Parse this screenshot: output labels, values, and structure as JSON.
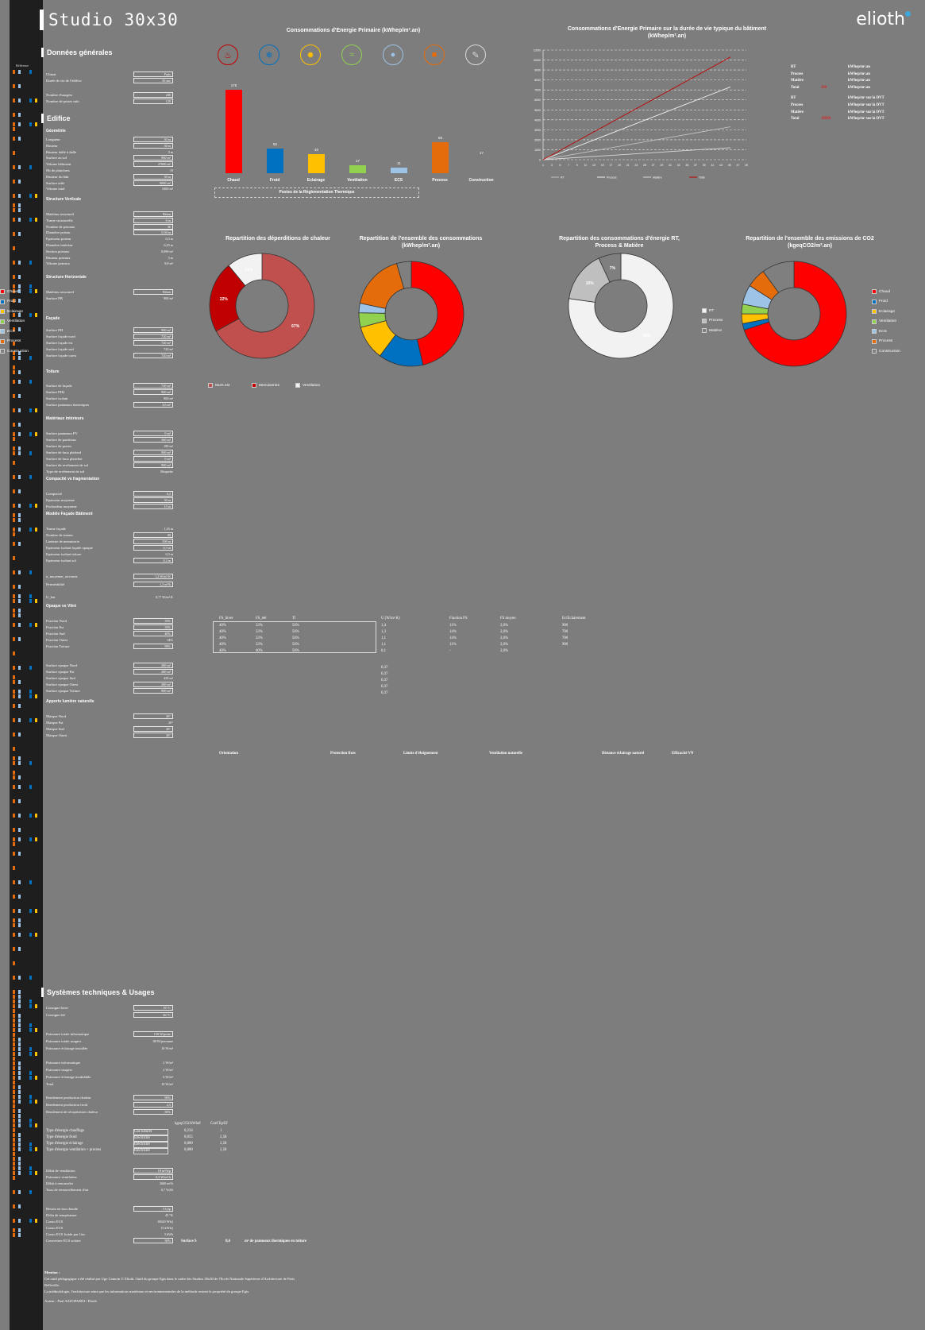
{
  "header": {
    "title": "Studio 30x30",
    "brand": "elioth"
  },
  "sections": {
    "general": "Données générales",
    "edifice": "Edifice",
    "systems": "Systèmes techniques & Usages"
  },
  "sidebar": {
    "reference_label": "Référence"
  },
  "general_params": [
    {
      "label": "Climat",
      "value": "Paris",
      "boxed": true
    },
    {
      "label": "Durée de vie de l'édifice",
      "value": "50 ans",
      "boxed": true
    },
    {
      "label": "Nombre d'usagers",
      "value": "200",
      "boxed": true
    },
    {
      "label": "Nombre de postes info",
      "value": "120",
      "boxed": true
    }
  ],
  "subheads": [
    "Géométrie",
    "Structure Verticale",
    "Structure Horizontale",
    "Façade",
    "Toiture",
    "Matériaux intérieurs",
    "Compacité vs fragmentation",
    "Modèle Façade Bâtiment",
    "Opaque vs Vitré",
    "Apports lumière naturelle"
  ],
  "geometry_params": [
    {
      "label": "Longueur",
      "value": "30 m"
    },
    {
      "label": "Hauteur",
      "value": "30 m"
    },
    {
      "label": "Hauteur dalle à dalle",
      "value": "3 m"
    },
    {
      "label": "Surface au sol",
      "value": "900 m²"
    },
    {
      "label": "Volume bâtiment",
      "value": "27000 m³"
    },
    {
      "label": "Nb de planchers",
      "value": "10"
    },
    {
      "label": "Hauteur du bâti",
      "value": "30 m"
    },
    {
      "label": "Surface utile",
      "value": "9000 m²"
    },
    {
      "label": "Volume total",
      "value": "5400 m³"
    }
  ],
  "structure_params": [
    {
      "label": "Matériau structurel",
      "value": "Béton"
    },
    {
      "label": "Trame structurelle",
      "value": "6 m"
    },
    {
      "label": "Nombre de poteaux",
      "value": "36"
    },
    {
      "label": "Diamètre poteau",
      "value": "0,30 m"
    },
    {
      "label": "Epaisseur poteau",
      "value": "0,3 m"
    },
    {
      "label": "Diamètre intérieur",
      "value": "0,25 m"
    },
    {
      "label": "Section poteaux",
      "value": "0,090 m²"
    },
    {
      "label": "Hauteur poteaux",
      "value": "3 m"
    },
    {
      "label": "Volume poteaux",
      "value": "9,8 m³"
    }
  ],
  "misc_params": [
    {
      "label": "Matériau structurel",
      "value": "Béton"
    },
    {
      "label": "Surface PB",
      "value": "900 m²"
    },
    {
      "label": "Surface PH",
      "value": "900 m²"
    },
    {
      "label": "Surface façade nord",
      "value": "720 m²"
    },
    {
      "label": "Surface façade est",
      "value": "720 m²"
    },
    {
      "label": "Surface façade sud",
      "value": "720 m²"
    },
    {
      "label": "Surface façade ouest",
      "value": "720 m²"
    },
    {
      "label": "Surface de façade",
      "value": "720 m²"
    },
    {
      "label": "Surface PH2",
      "value": "900 m²"
    },
    {
      "label": "Surface isolant",
      "value": "900 m²"
    },
    {
      "label": "Surface panneaux thermiques",
      "value": "3,6 m²"
    },
    {
      "label": "Surface panneaux PV",
      "value": "0 m²"
    },
    {
      "label": "Surface de partitions",
      "value": "360 m²"
    },
    {
      "label": "Surface de portes",
      "value": "180 m²"
    },
    {
      "label": "Surface de faux plafond",
      "value": "900 m²"
    },
    {
      "label": "Surface de faux plancher",
      "value": "0 m²"
    },
    {
      "label": "Surface de revêtement de sol",
      "value": "900 m²"
    },
    {
      "label": "Type de revêtement de sol",
      "value": "Moquette"
    },
    {
      "label": "Compacité",
      "value": "0,2"
    },
    {
      "label": "Epaisseur moyenne",
      "value": "30 m"
    },
    {
      "label": "Profondeur moyenne",
      "value": "15 m"
    },
    {
      "label": "Trame façade",
      "value": "1,35 m"
    },
    {
      "label": "Nombre de trames",
      "value": "88"
    },
    {
      "label": "Linéaire de menuiserie",
      "value": "500 m"
    },
    {
      "label": "Epaisseur isolant façade opaque",
      "value": "0,3 m"
    },
    {
      "label": "Epaisseur isolant toiture",
      "value": "0,3 m"
    },
    {
      "label": "Epaisseur isolant sol",
      "value": "0,2 m"
    },
    {
      "label": "u_moyenne_ouvrants",
      "value": "1,2 W/m².K"
    },
    {
      "label": "Perméabilité",
      "value": "1,2 m³/h"
    },
    {
      "label": "U_bat",
      "value": "0,77 W/m².K"
    },
    {
      "label": "Fraction Nord",
      "value": "33%"
    },
    {
      "label": "Fraction Est",
      "value": "33%"
    },
    {
      "label": "Fraction Sud",
      "value": "40%"
    },
    {
      "label": "Fraction Ouest",
      "value": "34%"
    },
    {
      "label": "Fraction Toiture",
      "value": "99%"
    },
    {
      "label": "Surface opaque Nord",
      "value": "480 m²"
    },
    {
      "label": "Surface opaque Est",
      "value": "480 m²"
    },
    {
      "label": "Surface opaque Sud",
      "value": "430 m²"
    },
    {
      "label": "Surface opaque Ouest",
      "value": "480 m²"
    },
    {
      "label": "Surface opaque Toiture",
      "value": "900 m²"
    },
    {
      "label": "Masque Nord",
      "value": "20°"
    },
    {
      "label": "Masque Est",
      "value": "20°"
    },
    {
      "label": "Masque Sud",
      "value": "20°"
    },
    {
      "label": "Masque Ouest",
      "value": "20°"
    }
  ],
  "charts_top": {
    "bar_title": "Consommations d'Energie Primaire (kWhep/m².an)",
    "reg_label": "Postes de la Règlementation Thermique",
    "line_title": "Consommations d'Energie Primaire sur la durée de vie typique du bâtiment (kWhep/m².an)"
  },
  "chart_data": [
    {
      "type": "bar",
      "title": "Consommations d'Energie Primaire (kWhep/m².an)",
      "categories": [
        "Chaud",
        "Froid",
        "Eclairage",
        "Ventilation",
        "ECS",
        "Process",
        "Construction"
      ],
      "values": [
        175,
        52,
        40,
        17,
        11,
        65,
        17
      ],
      "colors": [
        "#ff0000",
        "#0070c0",
        "#ffc000",
        "#92d050",
        "#9dc3e6",
        "#e46c0a",
        "#7d7d7d"
      ]
    },
    {
      "type": "line",
      "title": "Consommations d'Energie Primaire sur la durée de vie typique du bâtiment (kWhep/m².an)",
      "x": [
        1,
        3,
        5,
        7,
        9,
        11,
        13,
        15,
        17,
        19,
        21,
        23,
        25,
        27,
        29,
        31,
        33,
        35,
        37,
        39,
        41,
        43,
        45,
        47,
        49
      ],
      "ylim": [
        0,
        11000
      ],
      "series": [
        {
          "name": "RT",
          "color": "#bfbfbf",
          "values": [
            0,
            3300
          ]
        },
        {
          "name": "Process",
          "color": "#f2f2f2",
          "values": [
            0,
            7300
          ]
        },
        {
          "name": "Matière",
          "color": "#d9d9d9",
          "values": [
            0,
            1200
          ]
        },
        {
          "name": "Total",
          "color": "#c00000",
          "values": [
            0,
            10300
          ]
        }
      ]
    },
    {
      "type": "pie",
      "title": "Repartition des déperditions de chaleur",
      "labels": [
        "Murs ext",
        "Menuiseries",
        "Ventilation"
      ],
      "values": [
        67,
        22,
        11
      ],
      "colors": [
        "#c0504d",
        "#c00000",
        "#f2f2f2"
      ]
    },
    {
      "type": "pie",
      "title": "Repartition de l'ensemble des consommations (kWhep/m².an)",
      "labels": [
        "Chaud",
        "Froid",
        "Eclairage",
        "Ventilation",
        "ECS",
        "Process",
        "Construction"
      ],
      "values": [
        175,
        52,
        40,
        17,
        11,
        65,
        17
      ],
      "colors": [
        "#ff0000",
        "#0070c0",
        "#ffc000",
        "#92d050",
        "#9dc3e6",
        "#e46c0a",
        "#7f7f7f"
      ]
    },
    {
      "type": "pie",
      "title": "Repartition des consommations d'énergie RT, Process & Matière",
      "labels": [
        "RT",
        "Process",
        "Matière"
      ],
      "values": [
        78,
        16,
        7
      ],
      "colors": [
        "#f2f2f2",
        "#bfbfbf",
        "#7f7f7f"
      ]
    },
    {
      "type": "pie",
      "title": "Repartition de l'ensemble des emissions de CO2 (kgeqCO2/m².an)",
      "labels": [
        "Chaud",
        "Froid",
        "Eclairage",
        "Ventilation",
        "ECS",
        "Process",
        "Construction"
      ],
      "values": [
        70,
        2,
        3,
        3,
        6,
        6,
        10
      ],
      "colors": [
        "#ff0000",
        "#0070c0",
        "#ffc000",
        "#92d050",
        "#9dc3e6",
        "#e46c0a",
        "#7f7f7f"
      ]
    }
  ],
  "line_legend_right": [
    {
      "key": "RT",
      "unit": "kWhep/m².an"
    },
    {
      "key": "Process",
      "unit": "kWhep/m².an"
    },
    {
      "key": "Matière",
      "unit": "kWhep/m².an"
    },
    {
      "key": "Total",
      "value": "360",
      "unit": "kWhep/m².an"
    },
    {
      "key": "RT",
      "unit": "kWhep/m² sur la DVT"
    },
    {
      "key": "Process",
      "unit": "kWhep/m² sur la DVT"
    },
    {
      "key": "Matière",
      "unit": "kWhep/m² sur la DVT"
    },
    {
      "key": "Total",
      "value": "18000",
      "unit": "kWhep/m² sur la DVT"
    }
  ],
  "opaque_table": {
    "headers": [
      "FS_hiver",
      "FS_été",
      "Tl",
      "U (W/m².K)",
      "Fraction FS",
      "FS moyen",
      "Ec/Eclairement"
    ],
    "rows": [
      [
        "40%",
        "33%",
        "50%",
        "1,4",
        "11%",
        "2,0%",
        "900"
      ],
      [
        "40%",
        "33%",
        "50%",
        "1,3",
        "14%",
        "2,0%",
        "700"
      ],
      [
        "40%",
        "33%",
        "50%",
        "1,1",
        "14%",
        "2,0%",
        "700"
      ],
      [
        "40%",
        "33%",
        "50%",
        "1,1",
        "11%",
        "2,0%",
        "900"
      ],
      [
        "40%",
        "40%",
        "50%",
        "0,1",
        "-",
        "2,0%",
        ""
      ]
    ],
    "u_values": [
      "0,37",
      "0,37",
      "0,37",
      "0,37",
      "0,37"
    ]
  },
  "solar_header": [
    "Orientation",
    "Protection fixes",
    "Limite d'éloignement",
    "Ventilation naturelle",
    "Distance éclairage naturel",
    "Efficacité VN"
  ],
  "systems_params": [
    {
      "label": "Consigne hiver",
      "value": "19 °C"
    },
    {
      "label": "Consigne été",
      "value": "26 °C"
    },
    {
      "label": "Puissance totale informatique",
      "value": "150 W/poste"
    },
    {
      "label": "Puissance totale usagers",
      "value": "80 W/personne"
    },
    {
      "label": "Puissance éclairage installée",
      "value": "10 W/m²"
    },
    {
      "label": "Puissance informatique",
      "value": "2 W/m²"
    },
    {
      "label": "Puissance usagers",
      "value": "2 W/m²"
    },
    {
      "label": "Puissance éclairage modulable",
      "value": "6 W/m²"
    },
    {
      "label": "Total",
      "value": "10 W/m²"
    },
    {
      "label": "Rendement production chaleur",
      "value": "90%"
    },
    {
      "label": "Rendement production froid",
      "value": "2,5"
    },
    {
      "label": "Rendement de récupération chaleur",
      "value": "50%"
    }
  ],
  "energy_types": {
    "headers": [
      "kgeqCO2/kWhef",
      "Coef Ep/Ef"
    ],
    "rows": [
      {
        "label": "Type d'énergie chauffage",
        "type": "Gaz naturel",
        "co2": "0,234",
        "coef": "1"
      },
      {
        "label": "Type d'énergie froid",
        "type": "Electricité",
        "co2": "0,055",
        "coef": "2,58"
      },
      {
        "label": "Type d'énergie éclairage",
        "type": "Electricité",
        "co2": "0,080",
        "coef": "2,58"
      },
      {
        "label": "Type d'énergie ventilation + process",
        "type": "Electricité",
        "co2": "0,080",
        "coef": "2,58"
      }
    ]
  },
  "ventilation_params": [
    {
      "label": "Débit de ventilation",
      "value": "18 m³/h/p"
    },
    {
      "label": "Puissance ventilateur",
      "value": "0,3 W/m³.h"
    },
    {
      "label": "Débit à renouveler",
      "value": "3600 m³/h"
    },
    {
      "label": "Taux de renouvellement d'air",
      "value": "0,7 Vol/h"
    }
  ],
  "ecs_params": [
    {
      "label": "Besoin en eau chaude",
      "value": "3 l/j/p"
    },
    {
      "label": "Delta de température",
      "value": "45 °K"
    },
    {
      "label": "Conso ECS",
      "value": "10620 Wh/j"
    },
    {
      "label": "Conso ECS",
      "value": "15 kWh/j"
    },
    {
      "label": "Conso ECS froide par 1/m",
      "value": "3 kWh"
    },
    {
      "label": "Couverture ECS solaire",
      "value": "50%"
    }
  ],
  "ecs_note": {
    "a": "Surface S",
    "b": "8,6",
    "c": "m² de panneaux thermiques en toiture"
  },
  "footer": {
    "heading": "Mention :",
    "line1": "Cet outil pédagogique a été réalisé par Ugo Camoin © Elioth. Outil du groupe Egis dans le cadre des Studios 30x30 de l'Ecole Nationale Supérieure d'Architecture de Paris",
    "line2": "Belleville.",
    "line3": "La méthodologie, l'architecture ainsi que les informations matériaux et environnementales de la méthode restent la propriété du groupe Egis.",
    "line4": "Auteur : Paul AZZOPARDI / Elioth"
  },
  "colors": {
    "bg": "#7d7d7d",
    "sidebar": "#1e1e1e",
    "red": "#ff0000",
    "blue": "#0070c0",
    "yellow": "#ffc000",
    "green": "#92d050",
    "lightblue": "#9dc3e6",
    "orange": "#e46c0a"
  },
  "icons": [
    "heating-icon",
    "cooling-icon",
    "lighting-icon",
    "ventilation-icon",
    "water-icon",
    "process-icon",
    "construction-icon"
  ]
}
